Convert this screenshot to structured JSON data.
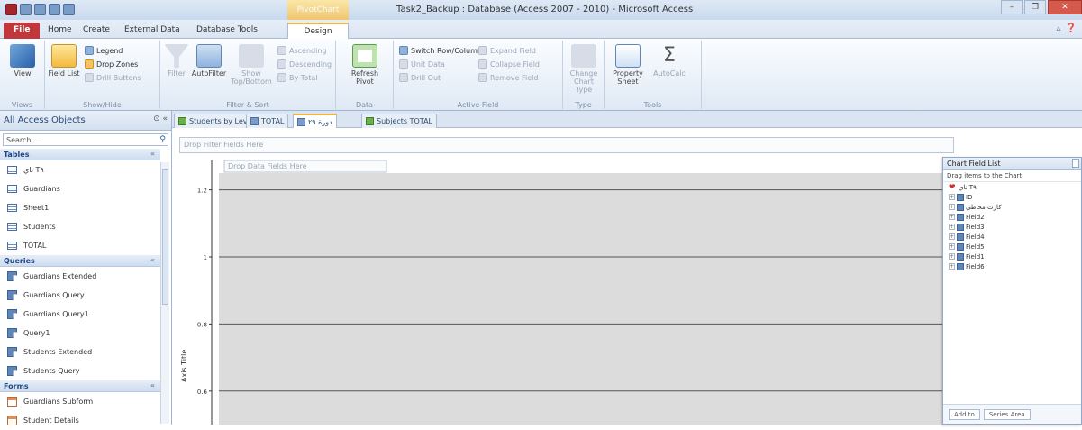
{
  "window": {
    "title": "Task2_Backup : Database (Access 2007 - 2010) - Microsoft Access",
    "contextual_tab_label": "PivotChart Tools"
  },
  "ribbon_tabs": [
    "File",
    "Home",
    "Create",
    "External Data",
    "Database Tools",
    "Design"
  ],
  "ribbon": {
    "groups": {
      "views": "Views",
      "show_hide": "Show/Hide",
      "filter_sort": "Filter & Sort",
      "data": "Data",
      "active_field": "Active Field",
      "type": "Type",
      "tools": "Tools"
    },
    "buttons": {
      "view": "View",
      "field_list": "Field List",
      "legend": "Legend",
      "drop_zones": "Drop Zones",
      "drill_buttons": "Drill Buttons",
      "filter": "Filter",
      "autofilter": "AutoFilter",
      "show_top_bottom": "Show Top/Bottom",
      "ascending": "Ascending",
      "descending": "Descending",
      "by_total": "By Total",
      "refresh_pivot": "Refresh Pivot",
      "switch_row_column": "Switch Row/Column",
      "unit_data": "Unit Data",
      "drill_out": "Drill Out",
      "expand_field": "Expand Field",
      "collapse_field": "Collapse Field",
      "remove_field": "Remove Field",
      "change_chart_type": "Change Chart Type",
      "property_sheet": "Property Sheet",
      "autocalc": "AutoCalc"
    }
  },
  "nav_pane": {
    "title": "All Access Objects",
    "search_placeholder": "Search...",
    "groups": [
      {
        "name": "Tables",
        "items": [
          "ناي T٩",
          "Guardians",
          "Sheet1",
          "Students",
          "TOTAL"
        ]
      },
      {
        "name": "Queries",
        "items": [
          "Guardians Extended",
          "Guardians Query",
          "Guardians Query1",
          "Query1",
          "Students Extended",
          "Students Query"
        ]
      },
      {
        "name": "Forms",
        "items": [
          "Guardians Subform",
          "Student Details"
        ]
      }
    ]
  },
  "doc_tabs": [
    "Students by Level",
    "TOTAL",
    "دورة ٢٩",
    "Subjects TOTAL"
  ],
  "chart": {
    "filter_zone": "Drop Filter Fields Here",
    "data_zone": "Drop Data Fields Here",
    "axis_title": "Axis Title"
  },
  "chart_data": {
    "type": "bar",
    "categories": [],
    "series": [],
    "ylabel": "Axis Title",
    "y_ticks": [
      1.2,
      1,
      0.8,
      0.6
    ],
    "ylim": [
      0.5,
      1.25
    ],
    "grid": true
  },
  "field_list": {
    "title": "Chart Field List",
    "subtitle": "Drag items to the Chart",
    "root": "ناي T٩",
    "fields": [
      "ID",
      "كارت مخاطي",
      "Field2",
      "Field3",
      "Field4",
      "Field5",
      "Field1",
      "Field6"
    ],
    "add_to": "Add to",
    "area": "Series Area"
  },
  "colors": {
    "file_tab": "#c0383b",
    "contextual": "#f7c35a",
    "plot_bg": "#dcdcdc",
    "ribbon": "#dfe9f5"
  }
}
